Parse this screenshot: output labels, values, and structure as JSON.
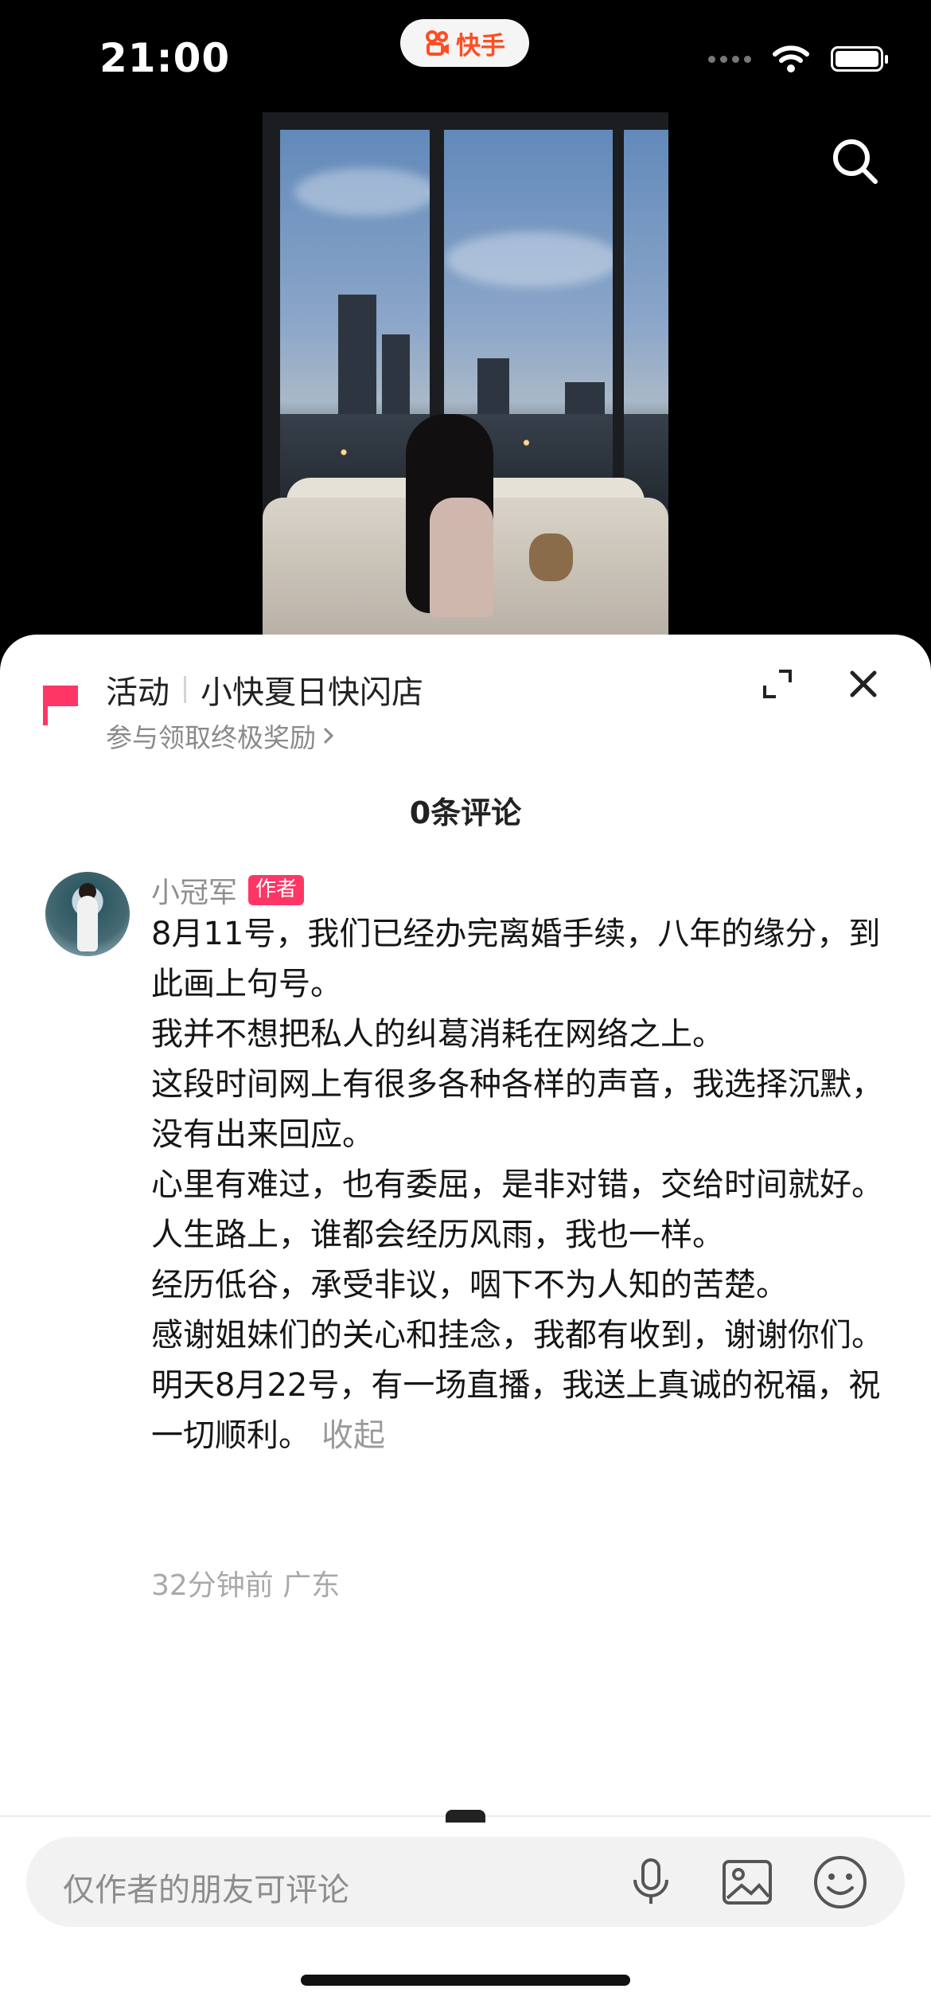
{
  "status_bar": {
    "time": "21:00",
    "app_name": "快手",
    "battery_level": 1.0
  },
  "video": {
    "search_icon": "search-icon"
  },
  "sheet": {
    "event_tag": "活动",
    "event_title": "小快夏日快闪店",
    "event_subtitle": "参与领取终极奖励",
    "comment_count": "0条评论",
    "comment": {
      "author": "小冠军",
      "badge": "作者",
      "lines": [
        "8月11号，我们已经办完离婚手续，八年的缘分，到此画上句号。",
        "我并不想把私人的纠葛消耗在网络之上。",
        "这段时间网上有很多各种各样的声音，我选择沉默，没有出来回应。",
        "心里有难过，也有委屈，是非对错，交给时间就好。",
        "人生路上，谁都会经历风雨，我也一样。",
        "经历低谷，承受非议，咽下不为人知的苦楚。",
        "感谢姐妹们的关心和挂念，我都有收到，谢谢你们。",
        "明天8月22号，有一场直播，我送上真诚的祝福，祝一切顺利。"
      ],
      "collapse_label": "收起",
      "meta": "32分钟前 广东"
    },
    "input_placeholder": "仅作者的朋友可评论",
    "colors": {
      "badge": "#fe3666",
      "flag": "#fe3666",
      "brand": "#ff4d22"
    }
  }
}
